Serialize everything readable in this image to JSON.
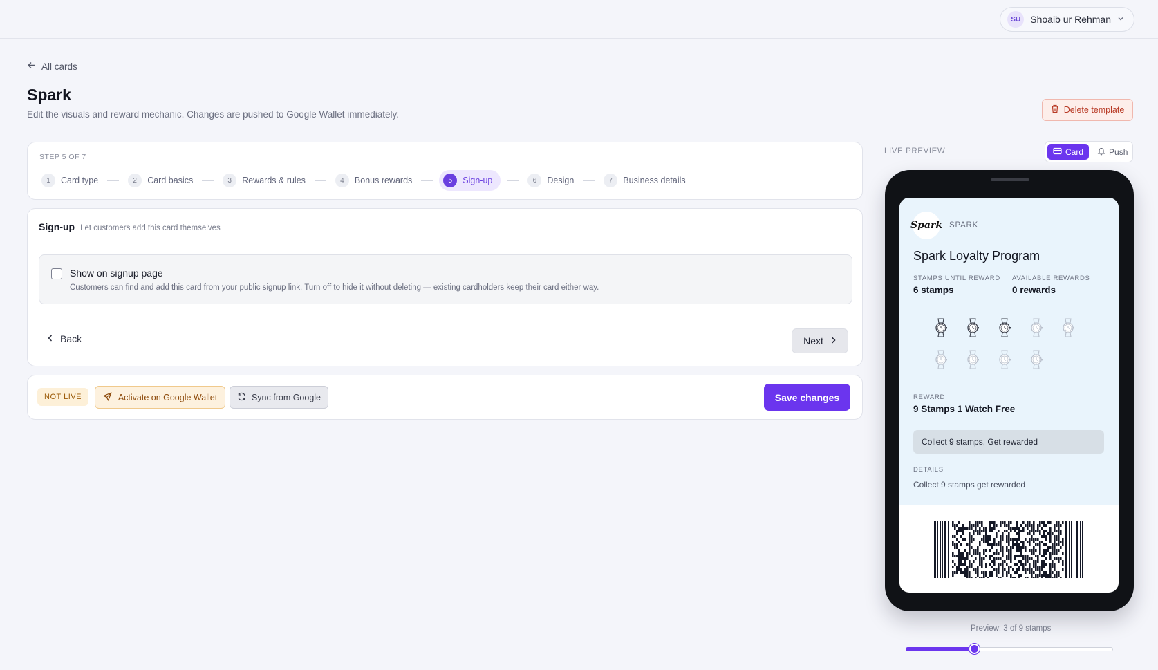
{
  "user": {
    "initials": "SU",
    "name": "Shoaib ur Rehman"
  },
  "header": {
    "back_label": "All cards",
    "title": "Spark",
    "subtitle": "Edit the visuals and reward mechanic. Changes are pushed to Google Wallet immediately.",
    "delete_label": "Delete template"
  },
  "stepper": {
    "label": "STEP 5 OF 7",
    "steps": [
      {
        "num": "1",
        "label": "Card type"
      },
      {
        "num": "2",
        "label": "Card basics"
      },
      {
        "num": "3",
        "label": "Rewards & rules"
      },
      {
        "num": "4",
        "label": "Bonus rewards"
      },
      {
        "num": "5",
        "label": "Sign-up"
      },
      {
        "num": "6",
        "label": "Design"
      },
      {
        "num": "7",
        "label": "Business details"
      }
    ],
    "active_index": 4
  },
  "signup": {
    "title": "Sign-up",
    "hint": "Let customers add this card themselves",
    "option_title": "Show on signup page",
    "option_desc": "Customers can find and add this card from your public signup link. Turn off to hide it without deleting — existing cardholders keep their card either way.",
    "option_checked": false,
    "back_label": "Back",
    "next_label": "Next"
  },
  "actions": {
    "status_badge": "NOT LIVE",
    "activate_label": "Activate on Google Wallet",
    "sync_label": "Sync from Google",
    "save_label": "Save changes"
  },
  "preview": {
    "label": "LIVE PREVIEW",
    "toggle": {
      "card": "Card",
      "push": "Push",
      "selected": "card"
    },
    "pass": {
      "logo_text": "Spark",
      "brand": "SPARK",
      "program_name": "Spark Loyalty Program",
      "stamps_until_label": "STAMPS UNTIL REWARD",
      "stamps_until_value": "6 stamps",
      "available_label": "AVAILABLE REWARDS",
      "available_value": "0 rewards",
      "stamps_total": 9,
      "stamps_filled": 3,
      "stamp_icon": "watch-icon",
      "reward_label": "REWARD",
      "reward_value": "9 Stamps 1 Watch Free",
      "reward_chip": "Collect 9 stamps, Get rewarded",
      "details_label": "DETAILS",
      "details_value": "Collect 9 stamps get rewarded"
    },
    "note": "Preview: 3 of 9 stamps",
    "slider_fraction": 0.33
  },
  "colors": {
    "accent": "#6b35ee",
    "pass_background": "#e9f4fc",
    "danger": "#b83a25",
    "warning": "#8d4a0b"
  }
}
